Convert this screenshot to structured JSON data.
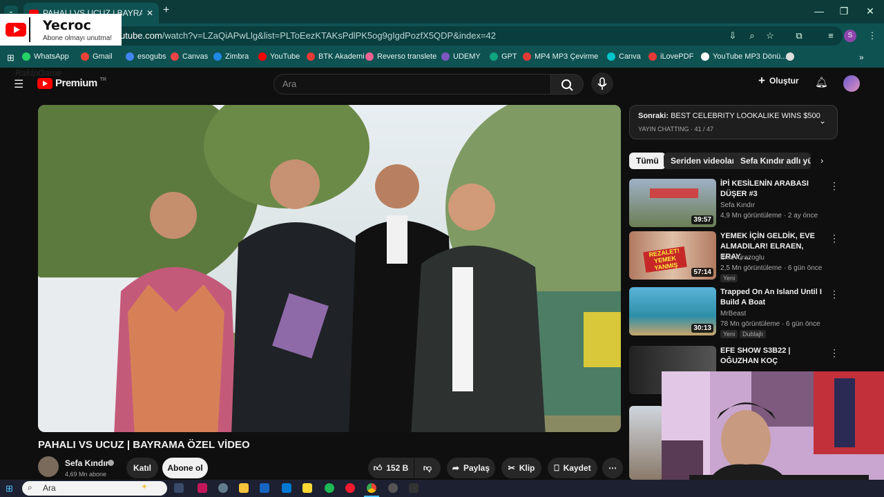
{
  "browser": {
    "tab_title": "PAHALI VS UCUZ | BAYRAMA Ö",
    "url_prefix": "utube.com",
    "url_rest": "/watch?v=LZaQiAPwLlg&list=PLToEezKTAKsPdlPK5og9gIgdPozfX5QDP&index=42",
    "profile_initial": "S",
    "bookmarks": [
      "WhatsApp",
      "Gmail",
      "esogubs",
      "Canvas",
      "Zimbra",
      "YouTube",
      "BTK Akademi",
      "Reverso translete",
      "UDEMY",
      "GPT",
      "MP4 MP3 Çevirme",
      "Canva",
      "iLovePDF",
      "YouTube MP3 Dönü..."
    ],
    "bookmark_colors": [
      "#25d366",
      "#ea4335",
      "#4285f4",
      "#e44",
      "#1e88e5",
      "#ff0000",
      "#e53935",
      "#f06292",
      "#7e57c2",
      "#10a37f",
      "#e53935",
      "#00c4cc",
      "#e53935",
      "#ffffff"
    ]
  },
  "overlay": {
    "channel": "Yecroc",
    "tagline": "Abone olmayı unutma!"
  },
  "youtube": {
    "logo_text": "Premium",
    "logo_sup": "TR",
    "watermark": "RakipGame",
    "search_placeholder": "Ara",
    "create_label": "Oluştur"
  },
  "video": {
    "title": "PAHALI VS UCUZ | BAYRAMA ÖZEL VİDEO",
    "channel": "Sefa Kındır",
    "subscribers": "4,69 Mn abone",
    "join_label": "Katıl",
    "subscribe_label": "Abone ol",
    "likes": "152 B",
    "share_label": "Paylaş",
    "clip_label": "Klip",
    "save_label": "Kaydet"
  },
  "sidebar": {
    "next_prefix": "Sonraki:",
    "next_title": "BEST CELEBRITY LOOKALIKE WINS $500",
    "playlist": "YAYIN CHATTING · 41 / 47",
    "chips": [
      "Tümü",
      "Seriden videolar",
      "Sefa Kındır adlı yükle"
    ],
    "recs": [
      {
        "title": "İPİ KESİLENİN ARABASI DÜŞER #3",
        "channel": "Sefa Kındır",
        "meta": "4,9 Mn görüntüleme · 2 ay önce",
        "duration": "39:57",
        "badge": ""
      },
      {
        "title": "YEMEK İÇİN GELDİK, EVE ALMADILAR! ELRAEN, ERAY, ...",
        "channel": "Enis Kirazoglu",
        "meta": "2,5 Mn görüntüleme · 6 gün önce",
        "duration": "57:14",
        "badge": "Yeni"
      },
      {
        "title": "Trapped On An Island Until I Build A Boat",
        "channel": "MrBeast",
        "meta": "78 Mn görüntüleme · 6 gün önce",
        "duration": "30:13",
        "badge": "Yeni",
        "badge2": "Dublajlı"
      },
      {
        "title": "EFE SHOW S3B22 | OĞUZHAN KOÇ",
        "channel": "",
        "meta": "",
        "duration": "",
        "badge": ""
      }
    ],
    "thumb_overlay": "REZALET! YEMEK YANMIŞ"
  },
  "taskbar": {
    "search_placeholder": "Ara"
  }
}
